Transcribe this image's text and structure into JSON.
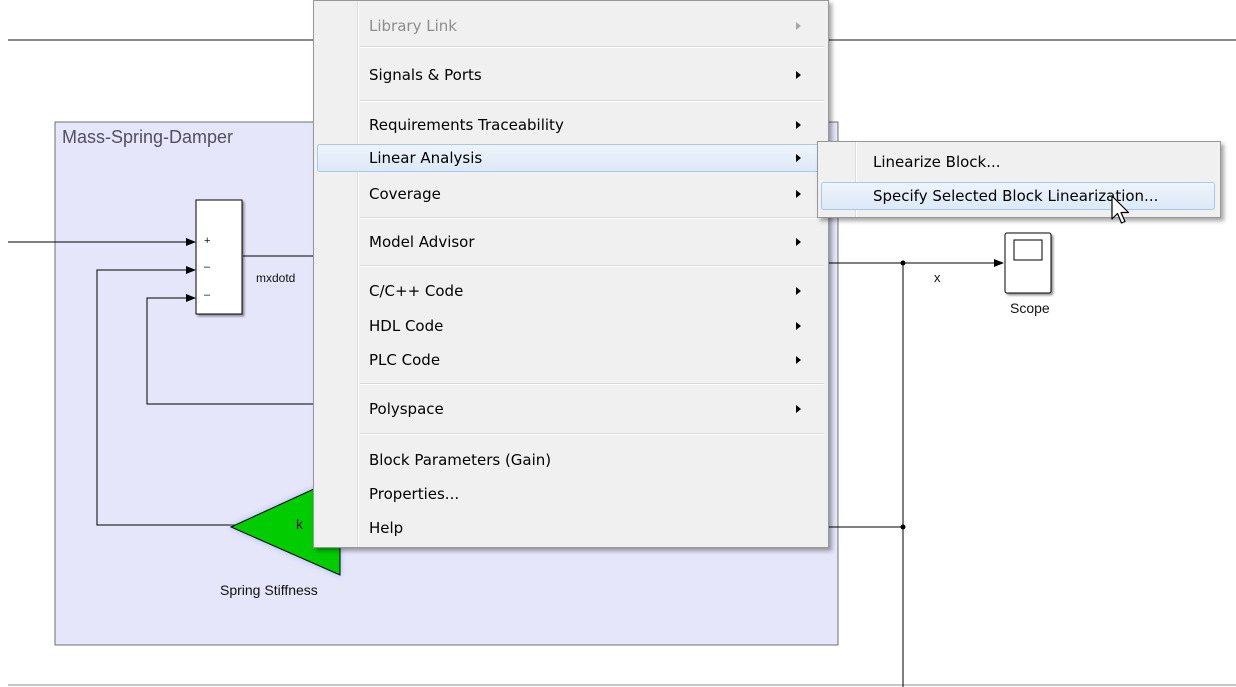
{
  "diagram": {
    "subsystem_title": "Mass-Spring-Damper",
    "sum_signs": [
      "+",
      "–",
      "–"
    ],
    "signal_label": "mxdotd",
    "gain_symbol": "k",
    "gain_name": "Spring Stiffness",
    "output_signal": "x",
    "scope_name": "Scope"
  },
  "context_menu": {
    "items": [
      {
        "label": "Library Link",
        "submenu": true,
        "disabled": true
      },
      {
        "label": "Signals & Ports",
        "submenu": true
      },
      {
        "label": "Requirements Traceability",
        "submenu": true
      },
      {
        "label": "Linear Analysis",
        "submenu": true,
        "highlighted": true
      },
      {
        "label": "Coverage",
        "submenu": true
      },
      {
        "label": "Model Advisor",
        "submenu": true
      },
      {
        "label": "C/C++ Code",
        "submenu": true
      },
      {
        "label": "HDL Code",
        "submenu": true
      },
      {
        "label": "PLC Code",
        "submenu": true
      },
      {
        "label": "Polyspace",
        "submenu": true
      },
      {
        "label": "Block Parameters (Gain)",
        "submenu": false
      },
      {
        "label": "Properties...",
        "submenu": false
      },
      {
        "label": "Help",
        "submenu": false
      }
    ]
  },
  "submenu": {
    "items": [
      {
        "label": "Linearize Block..."
      },
      {
        "label": "Specify Selected Block Linearization...",
        "highlighted": true
      }
    ]
  },
  "icons": [
    "submenu-arrow-icon",
    "mouse-pointer-icon",
    "scope-screen-icon"
  ],
  "colors": {
    "subsystem_fill": "#e6e6fa",
    "gain_fill": "#00cc00",
    "menu_background": "#f0f0f0",
    "menu_highlight": "#dce9f7"
  }
}
